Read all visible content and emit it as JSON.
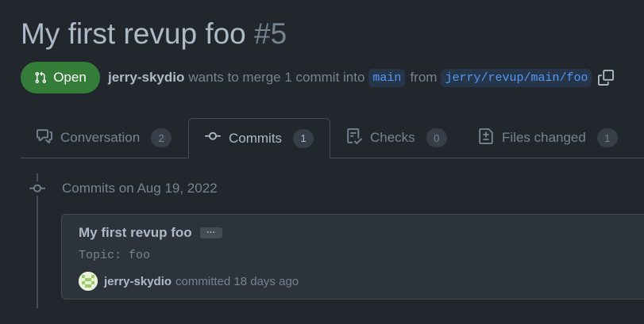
{
  "pr": {
    "title": "My first revup foo",
    "number": "#5",
    "status_label": "Open",
    "author": "jerry-skydio",
    "merge_text": "wants to merge 1 commit into",
    "base_branch": "main",
    "from_text": "from",
    "head_branch": "jerry/revup/main/foo"
  },
  "tabs": [
    {
      "label": "Conversation",
      "count": "2",
      "icon": "comment-discussion-icon"
    },
    {
      "label": "Commits",
      "count": "1",
      "icon": "git-commit-icon"
    },
    {
      "label": "Checks",
      "count": "0",
      "icon": "checklist-icon"
    },
    {
      "label": "Files changed",
      "count": "1",
      "icon": "file-diff-icon"
    }
  ],
  "timeline": {
    "date_heading": "Commits on Aug 19, 2022",
    "commit": {
      "title": "My first revup foo",
      "ellipsis": "···",
      "topic": "Topic: foo",
      "author": "jerry-skydio",
      "committed_text": "committed 18 days ago"
    }
  },
  "colors": {
    "background": "#22272e",
    "open_green": "#347d39",
    "link_blue": "#539bf5"
  }
}
